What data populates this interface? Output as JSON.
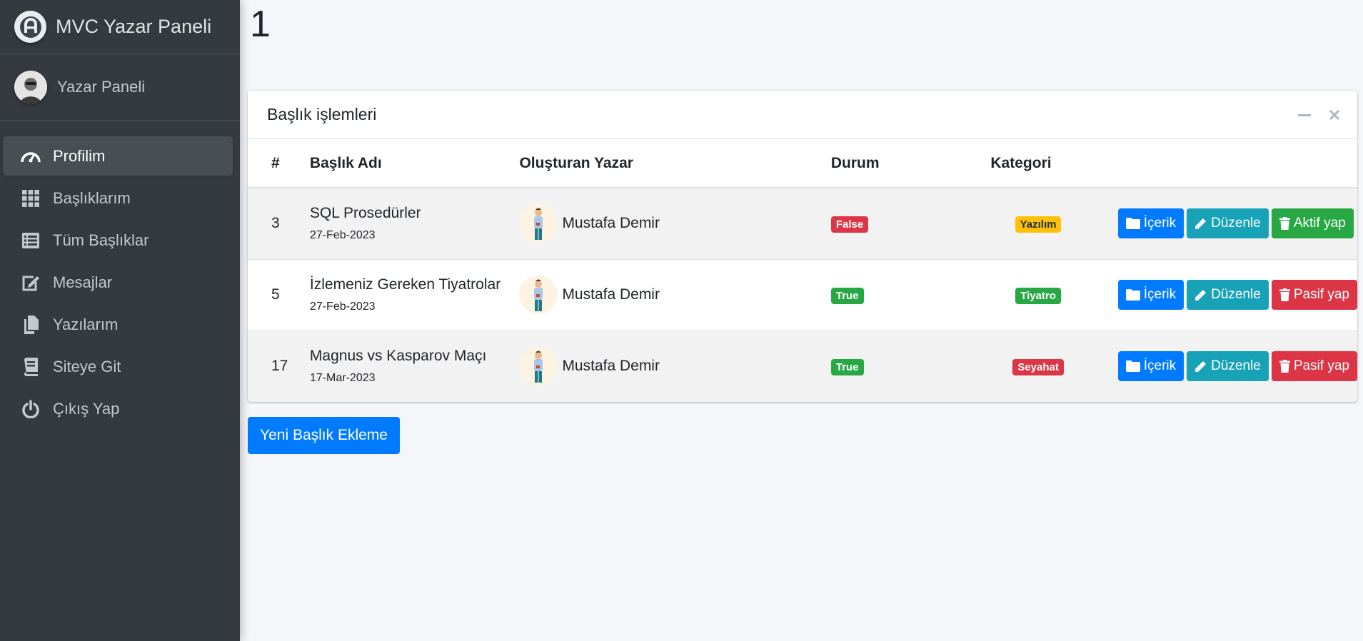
{
  "brand": {
    "title": "MVC Yazar Paneli",
    "logo_icon": "adminlte-logo-icon"
  },
  "user": {
    "name": "Yazar Paneli"
  },
  "sidebar": {
    "items": [
      {
        "label": "Profilim",
        "icon": "tachometer-icon",
        "active": true
      },
      {
        "label": "Başlıklarım",
        "icon": "grid-icon",
        "active": false
      },
      {
        "label": "Tüm Başlıklar",
        "icon": "list-icon",
        "active": false
      },
      {
        "label": "Mesajlar",
        "icon": "edit-icon",
        "active": false
      },
      {
        "label": "Yazılarım",
        "icon": "copy-icon",
        "active": false
      },
      {
        "label": "Siteye Git",
        "icon": "book-icon",
        "active": false
      },
      {
        "label": "Çıkış Yap",
        "icon": "power-icon",
        "active": false
      }
    ]
  },
  "page": {
    "number": "1"
  },
  "card": {
    "title": "Başlık işlemleri",
    "columns": [
      "#",
      "Başlık Adı",
      "Oluşturan Yazar",
      "Durum",
      "Kategori",
      ""
    ],
    "rows": [
      {
        "id": "3",
        "title": "SQL Prosedürler",
        "date": "27-Feb-2023",
        "author": "Mustafa Demir",
        "status": "False",
        "category": "Yazılım",
        "btn_content": "İçerik",
        "btn_edit": "Düzenle",
        "btn_toggle": "Aktif yap"
      },
      {
        "id": "5",
        "title": "İzlemeniz Gereken Tiyatrolar",
        "date": "27-Feb-2023",
        "author": "Mustafa Demir",
        "status": "True",
        "category": "Tiyatro",
        "btn_content": "İçerik",
        "btn_edit": "Düzenle",
        "btn_toggle": "Pasif yap"
      },
      {
        "id": "17",
        "title": "Magnus vs Kasparov Maçı",
        "date": "17-Mar-2023",
        "author": "Mustafa Demir",
        "status": "True",
        "category": "Seyahat",
        "btn_content": "İçerik",
        "btn_edit": "Düzenle",
        "btn_toggle": "Pasif yap"
      }
    ]
  },
  "add_button": {
    "label": "Yeni Başlık Ekleme"
  },
  "colors": {
    "sidebar": "#343a40",
    "primary": "#007bff",
    "info": "#17a2b8",
    "success": "#28a745",
    "danger": "#dc3545",
    "warning": "#ffc107"
  }
}
